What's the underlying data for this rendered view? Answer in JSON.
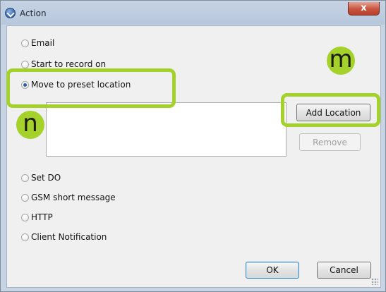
{
  "window": {
    "title": "Action",
    "close_glyph": "x"
  },
  "options": [
    {
      "label": "Email",
      "checked": false
    },
    {
      "label": "Start to record on",
      "checked": false
    },
    {
      "label": "Move to preset location",
      "checked": true
    },
    {
      "label": "Set DO",
      "checked": false
    },
    {
      "label": "GSM short message",
      "checked": false
    },
    {
      "label": "HTTP",
      "checked": false
    },
    {
      "label": "Client Notification",
      "checked": false
    }
  ],
  "location_panel": {
    "add_label": "Add Location",
    "remove_label": "Remove",
    "remove_enabled": false
  },
  "footer": {
    "ok_label": "OK",
    "cancel_label": "Cancel"
  },
  "callouts": {
    "m": "m",
    "n": "n",
    "color": "#a4d22b"
  },
  "icons": {
    "app": "app-logo-icon",
    "close": "close-icon"
  }
}
